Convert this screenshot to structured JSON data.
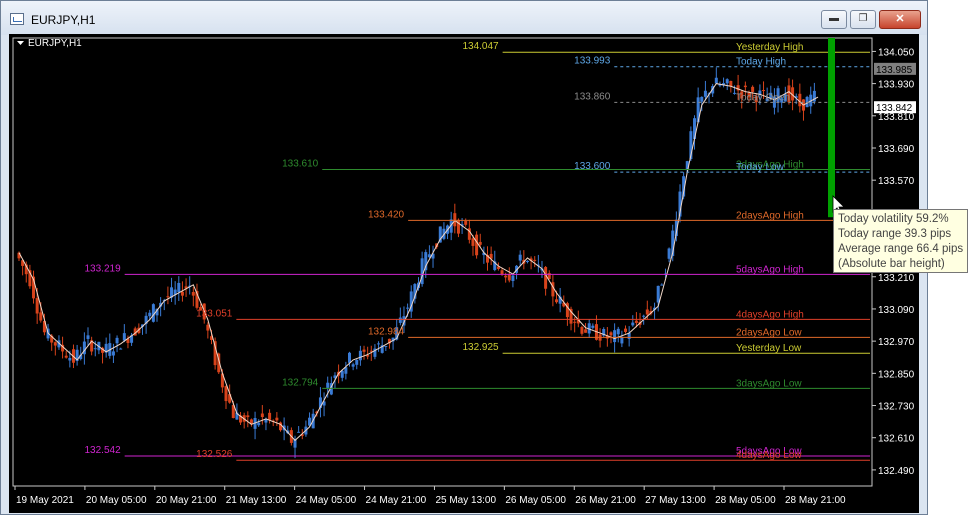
{
  "window": {
    "title": "EURJPY,H1"
  },
  "chart": {
    "symbol_label": "EURJPY,H1"
  },
  "colors": {
    "background": "#000000",
    "bull": "#3a7bd5",
    "bear": "#d8431b",
    "ma": "#f2d8c8",
    "yesterday": "#cccc33",
    "today": "#5fa8e8",
    "today_open": "#8c8c8c",
    "days3": "#2e8b2e",
    "days2": "#e0692a",
    "days4": "#e0402a",
    "days5": "#d025d0",
    "vol_bar": "#00a000"
  },
  "price_axis": {
    "min": 132.43,
    "max": 134.1,
    "ticks": [
      "134.050",
      "133.930",
      "133.810",
      "133.690",
      "133.570",
      "133.450",
      "133.330",
      "133.210",
      "133.090",
      "132.970",
      "132.850",
      "132.730",
      "132.610",
      "132.490"
    ],
    "labels": [
      {
        "text": "133.985",
        "price": 133.985,
        "style": "gray"
      },
      {
        "text": "133.842",
        "price": 133.842,
        "style": "white"
      }
    ]
  },
  "time_axis": {
    "labels": [
      "19 May 2021",
      "20 May 05:00",
      "20 May 21:00",
      "21 May 13:00",
      "24 May 05:00",
      "24 May 21:00",
      "25 May 13:00",
      "26 May 05:00",
      "26 May 21:00",
      "27 May 13:00",
      "28 May 05:00",
      "28 May 21:00"
    ]
  },
  "levels": [
    {
      "name": "Yesterday High",
      "value_text": "134.047",
      "price": 134.047,
      "color_key": "yesterday",
      "start": 0.57
    },
    {
      "name": "Today High",
      "value_text": "133.993",
      "price": 133.993,
      "color_key": "today",
      "start": 0.7
    },
    {
      "name": "Today Open",
      "value_text": "133.860",
      "price": 133.86,
      "color_key": "today_open",
      "start": 0.7
    },
    {
      "name": "3daysAgo High",
      "value_text": "133.610",
      "price": 133.61,
      "color_key": "days3",
      "start": 0.36
    },
    {
      "name": "Today Low",
      "value_text": "133.600",
      "price": 133.6,
      "color_key": "today",
      "start": 0.7
    },
    {
      "name": "2daysAgo High",
      "value_text": "133.420",
      "price": 133.42,
      "color_key": "days2",
      "start": 0.46
    },
    {
      "name": "5daysAgo High",
      "value_text": "133.219",
      "price": 133.219,
      "color_key": "days5",
      "start": 0.13
    },
    {
      "name": "4daysAgo High",
      "value_text": "133.051",
      "price": 133.051,
      "color_key": "days4",
      "start": 0.26
    },
    {
      "name": "2daysAgo Low",
      "value_text": "132.984",
      "price": 132.984,
      "color_key": "days2",
      "start": 0.46
    },
    {
      "name": "Yesterday Low",
      "value_text": "132.925",
      "price": 132.925,
      "color_key": "yesterday",
      "start": 0.57
    },
    {
      "name": "3daysAgo Low",
      "value_text": "132.794",
      "price": 132.794,
      "color_key": "days3",
      "start": 0.36
    },
    {
      "name": "5daysAgo Low",
      "value_text": "132.542",
      "price": 132.542,
      "color_key": "days5",
      "start": 0.13
    },
    {
      "name": "4daysAgo Low",
      "value_text": "132.526",
      "price": 132.526,
      "color_key": "days4",
      "start": 0.26
    }
  ],
  "tooltip": {
    "volatility": "Today volatility 59.2%",
    "range": "Today range 39.3 pips",
    "avg_range": "Average range 66.4 pips",
    "note": "(Absolute bar height)"
  },
  "volatility": {
    "fraction": 0.592
  },
  "chart_data": {
    "type": "line",
    "title": "EURJPY,H1",
    "ylim": [
      132.43,
      134.1
    ],
    "x": [
      "19 May 2021",
      "20 May 05:00",
      "20 May 21:00",
      "21 May 13:00",
      "24 May 05:00",
      "24 May 21:00",
      "25 May 13:00",
      "26 May 05:00",
      "26 May 21:00",
      "27 May 13:00",
      "28 May 05:00",
      "28 May 21:00"
    ],
    "series": [
      {
        "values": [
          133.3,
          133.2,
          133.0,
          132.95,
          132.9,
          132.97,
          132.93,
          132.96,
          133.0,
          133.05,
          133.12,
          133.15,
          133.18,
          133.05,
          132.85,
          132.7,
          132.66,
          132.68,
          132.66,
          132.6,
          132.65,
          132.75,
          132.85,
          132.9,
          132.92,
          132.95,
          132.98,
          133.1,
          133.25,
          133.35,
          133.42,
          133.38,
          133.3,
          133.25,
          133.22,
          133.28,
          133.24,
          133.15,
          133.08,
          133.02,
          133.0,
          132.98,
          133.0,
          133.05,
          133.1,
          133.3,
          133.6,
          133.85,
          133.93,
          133.92,
          133.9,
          133.89,
          133.87,
          133.9,
          133.85,
          133.88
        ]
      }
    ]
  }
}
